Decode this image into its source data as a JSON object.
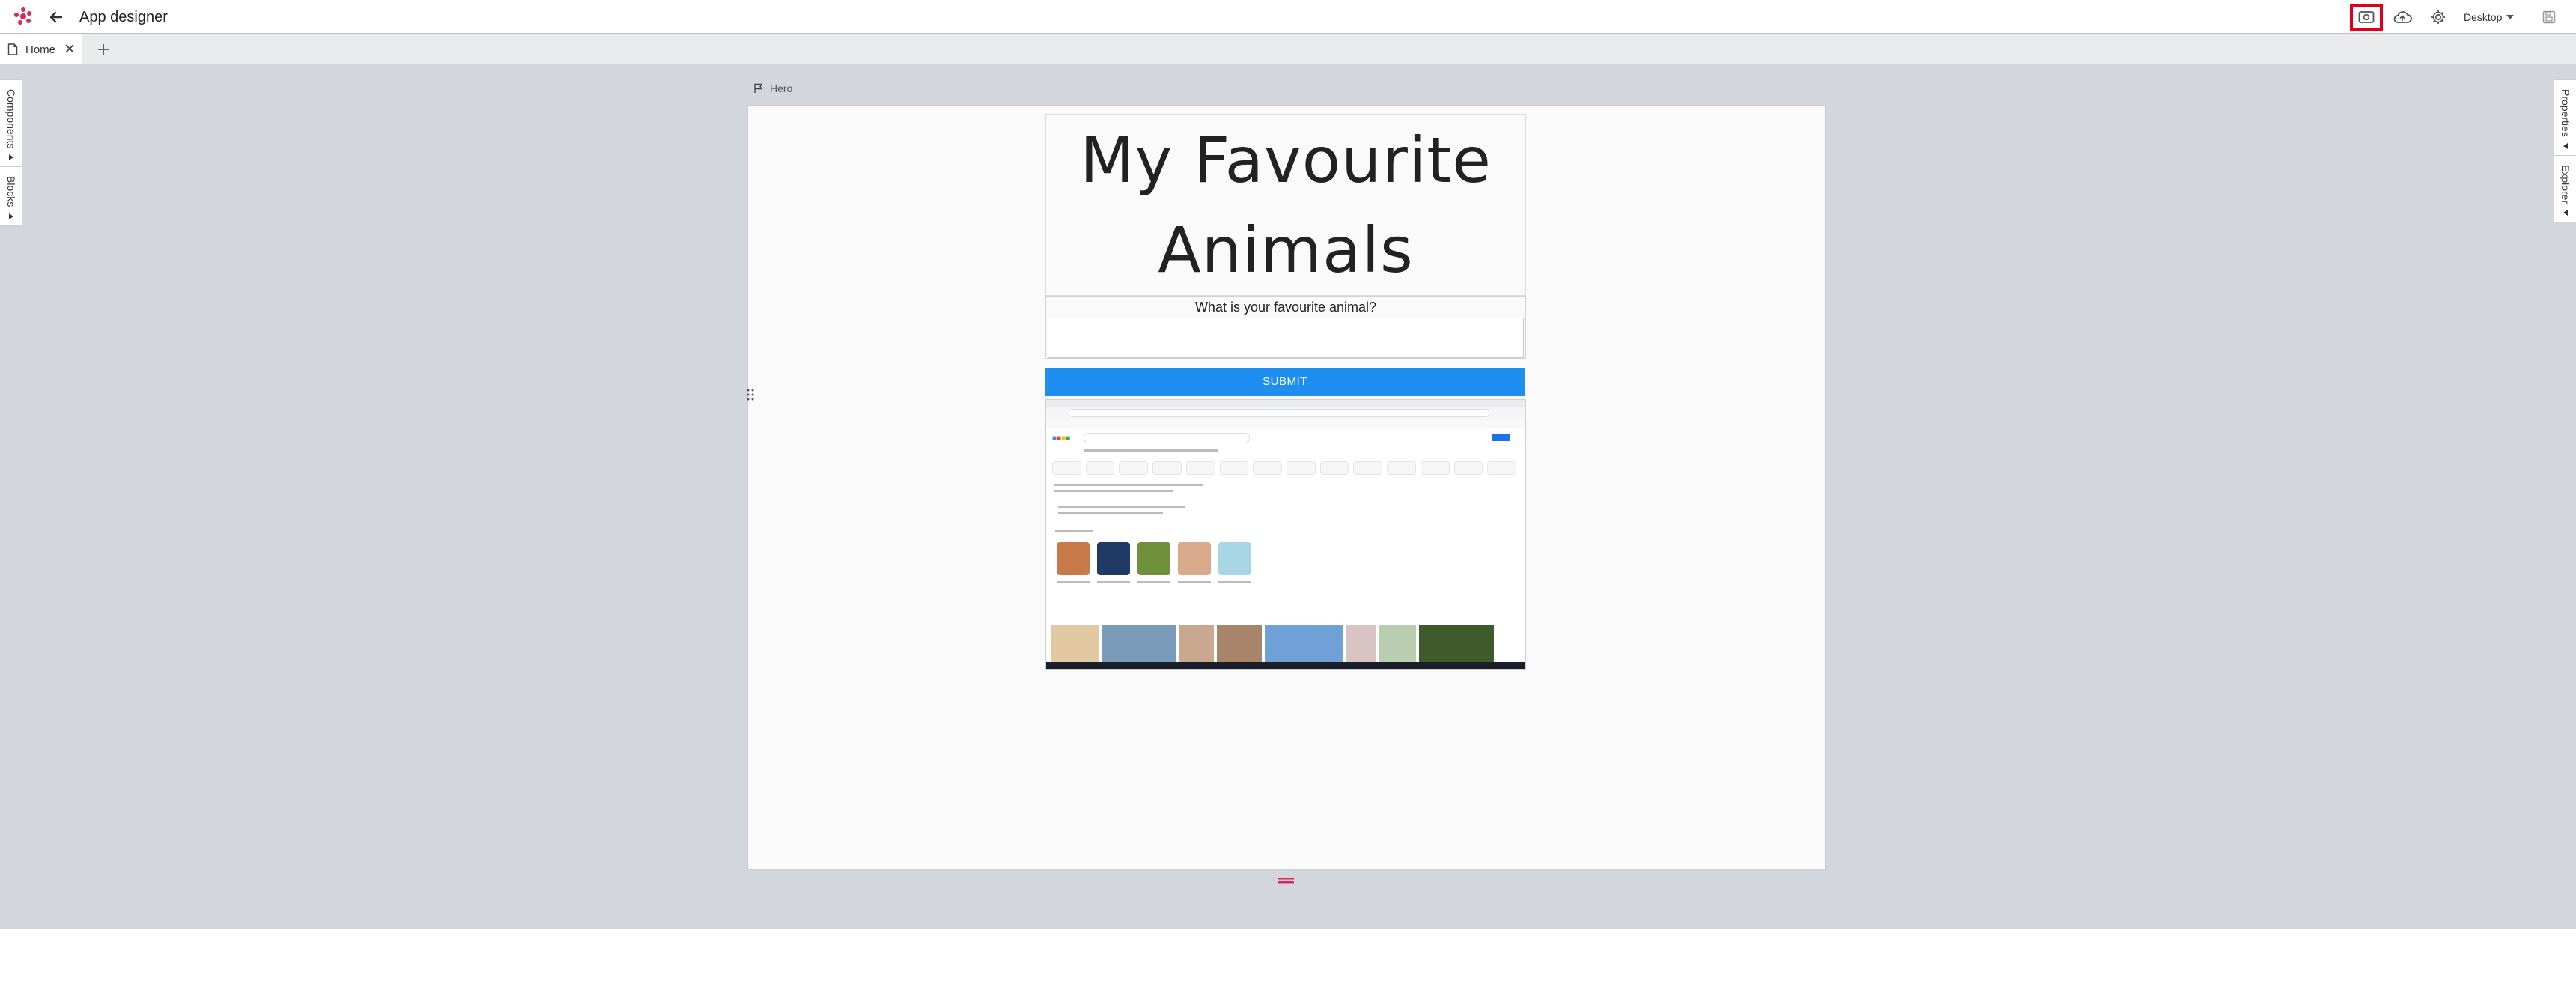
{
  "app": {
    "title": "App designer",
    "device": "Desktop"
  },
  "tabs": [
    {
      "label": "Home"
    }
  ],
  "side_left": {
    "tabs": [
      "Components",
      "Blocks"
    ]
  },
  "side_right": {
    "tabs": [
      "Properties",
      "Explorer"
    ]
  },
  "hero": {
    "label": "Hero"
  },
  "page": {
    "heading": "My Favourite Animals",
    "question": "What is your favourite animal?",
    "answer_value": "",
    "submit_label": "SUBMIT"
  },
  "embedded_image": {
    "description_icon": "google-search-screenshot"
  },
  "icons": {
    "logo": "logo-icon",
    "back": "arrow-left-icon",
    "screenshot": "screenshot-icon",
    "cloud": "cloud-upload-icon",
    "settings": "gear-icon",
    "save": "save-icon",
    "file": "file-icon",
    "close": "close-icon",
    "add": "plus-icon",
    "flag": "flag-icon",
    "drag": "drag-handle-icon"
  },
  "colors": {
    "accent": "#1e8ff0",
    "highlight": "#e0001b",
    "brand": "#e0245e",
    "canvas": "#d3d6dd"
  }
}
